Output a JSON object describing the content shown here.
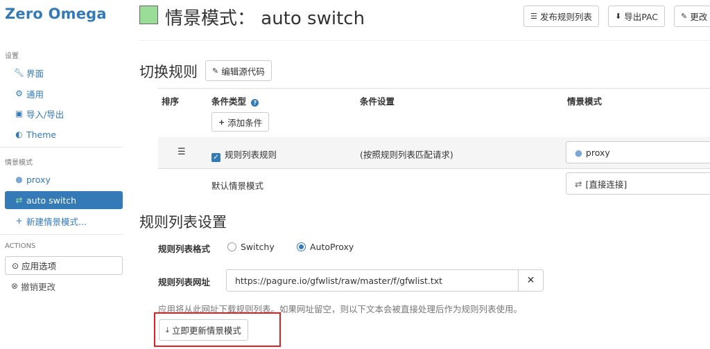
{
  "app": {
    "brand": "Zero Omega"
  },
  "sidebar": {
    "settings_header": "设置",
    "settings_items": [
      {
        "label": "界面",
        "icon": "wrench-icon"
      },
      {
        "label": "通用",
        "icon": "gear-icon"
      },
      {
        "label": "导入/导出",
        "icon": "floppy-icon"
      },
      {
        "label": "Theme",
        "icon": "half-circle-icon"
      }
    ],
    "profiles_header": "情景模式",
    "profile_items": [
      {
        "label": "proxy",
        "icon": "globe-icon",
        "active": false
      },
      {
        "label": "auto switch",
        "icon": "retweet-icon",
        "active": true
      },
      {
        "label": "新建情景模式...",
        "icon": "plus-icon",
        "active": false
      }
    ],
    "actions_header": "ACTIONS",
    "apply_label": "应用选项",
    "discard_label": "撤销更改"
  },
  "header": {
    "profile_color": "#99dd99",
    "title": "情景模式： auto switch",
    "buttons": [
      {
        "label": "发布规则列表",
        "icon": "list-icon"
      },
      {
        "label": "导出PAC",
        "icon": "download-circle-icon"
      },
      {
        "label": "更改",
        "icon": "edit-icon"
      }
    ]
  },
  "switch_rules": {
    "heading": "切换规则",
    "edit_source_label": "编辑源代码",
    "columns": {
      "order": "排序",
      "condition_type": "条件类型",
      "condition_settings": "条件设置",
      "profile": "情景模式"
    },
    "add_condition_label": "添加条件",
    "rules": [
      {
        "condition_type": "规则列表规则",
        "checked": true,
        "condition_settings": "(按照规则列表匹配请求)",
        "profile": "proxy",
        "profile_icon": "globe-icon"
      }
    ],
    "default_row": {
      "label": "默认情景模式",
      "profile": "[直接连接]",
      "profile_icon": "exchange-icon"
    }
  },
  "rule_list": {
    "heading": "规则列表设置",
    "format_label": "规则列表格式",
    "formats": [
      {
        "label": "Switchy",
        "selected": false
      },
      {
        "label": "AutoProxy",
        "selected": true
      }
    ],
    "url_label": "规则列表网址",
    "url_value": "https://pagure.io/gfwlist/raw/master/f/gfwlist.txt",
    "help_text": "应用将从此网址下载规则列表。如果网址留空，则以下文本会被直接处理后作为规则列表使用。",
    "update_label": "立即更新情景模式"
  },
  "colors": {
    "accent": "#337ab7",
    "highlight": "#e02020"
  }
}
